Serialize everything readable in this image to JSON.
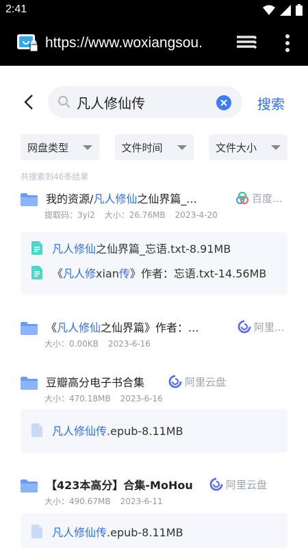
{
  "statusbar": {
    "time": "2:41"
  },
  "browser": {
    "url": "https://www.woxiangsou."
  },
  "search": {
    "query": "凡人修仙传",
    "button_label": "搜索"
  },
  "filters": [
    {
      "label": "网盘类型"
    },
    {
      "label": "文件时间"
    },
    {
      "label": "文件大小"
    }
  ],
  "result_count": "共搜索到46条结果",
  "results": [
    {
      "title_prefix": "我的资源/",
      "title_highlight": "凡人修仙",
      "title_suffix": "之仙界篇_...",
      "source": "百度...",
      "code": "提取码：3yi2",
      "size": "大小：26.76MB",
      "date": "2023-4-20",
      "files": [
        {
          "highlight": "凡人修仙",
          "rest": "之仙界篇_忘语.txt-8.91MB"
        },
        {
          "prefix": "《",
          "highlight": "凡人修",
          "middle": "xian",
          "highlight2": "传",
          "rest": "》作者：忘语.txt-14.56MB"
        }
      ]
    },
    {
      "title_prefix": "《",
      "title_highlight": "凡人修仙",
      "title_suffix": "之仙界篇》作者：...",
      "source": "阿里...",
      "size": "大小：0.00KB",
      "date": "2023-6-16"
    },
    {
      "title": "豆瓣高分电子书合集",
      "source": "阿里云盘",
      "size": "大小：470.18MB",
      "date": "2023-6-16",
      "files": [
        {
          "highlight": "凡人修仙传",
          "rest": ".epub-8.11MB"
        }
      ]
    },
    {
      "title": "【423本高分】合集-MoHou",
      "source": "阿里云盘",
      "size": "大小：490.67MB",
      "date": "2023-6-11",
      "files": [
        {
          "highlight": "凡人修仙传",
          "rest": ".epub-8.11MB"
        }
      ]
    }
  ],
  "colors": {
    "accent": "#2e6fe6",
    "folder": "#6b9cf5",
    "txt_icon": "#4fd6c7",
    "epub_icon": "#c8daf6"
  }
}
